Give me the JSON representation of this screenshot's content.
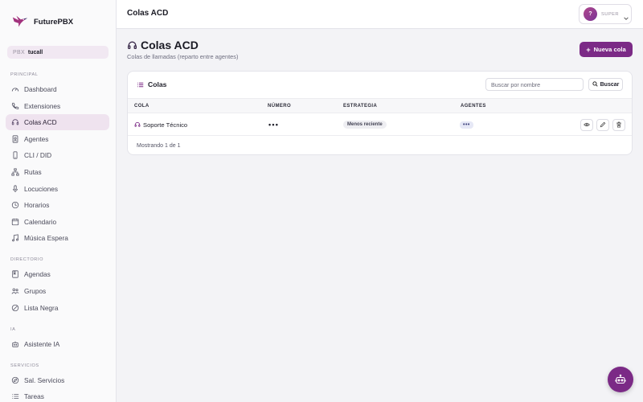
{
  "brand": {
    "name": "FuturePBX"
  },
  "pbx": {
    "label": "PBX",
    "value": "tucall"
  },
  "sidebar": {
    "sections": [
      {
        "title": "PRINCIPAL",
        "items": [
          {
            "label": "Dashboard",
            "icon": "dashboard-icon"
          },
          {
            "label": "Extensiones",
            "icon": "phone-icon"
          },
          {
            "label": "Colas ACD",
            "icon": "headset-icon",
            "active": true
          },
          {
            "label": "Agentes",
            "icon": "id-badge-icon"
          },
          {
            "label": "CLI / DID",
            "icon": "mobile-icon"
          },
          {
            "label": "Rutas",
            "icon": "routes-icon"
          },
          {
            "label": "Locuciones",
            "icon": "microphone-icon"
          },
          {
            "label": "Horarios",
            "icon": "clock-icon"
          },
          {
            "label": "Calendario",
            "icon": "calendar-icon"
          },
          {
            "label": "Música Espera",
            "icon": "music-icon"
          }
        ]
      },
      {
        "title": "DIRECTORIO",
        "items": [
          {
            "label": "Agendas",
            "icon": "book-icon"
          },
          {
            "label": "Grupos",
            "icon": "users-icon"
          },
          {
            "label": "Lista Negra",
            "icon": "block-icon"
          }
        ]
      },
      {
        "title": "IA",
        "items": [
          {
            "label": "Asistente IA",
            "icon": "robot-icon"
          }
        ]
      },
      {
        "title": "SERVICIOS",
        "items": [
          {
            "label": "Sal. Servicios",
            "icon": "compass-icon"
          },
          {
            "label": "Tareas",
            "icon": "list-icon"
          }
        ]
      }
    ]
  },
  "topbar": {
    "title": "Colas ACD",
    "avatar_initial": "?",
    "role": "SUPER"
  },
  "page": {
    "title": "Colas ACD",
    "subtitle": "Colas de llamadas (reparto entre agentes)",
    "new_button": "Nueva cola"
  },
  "card": {
    "title": "Colas",
    "search_placeholder": "Buscar por nombre",
    "search_button": "Buscar",
    "columns": [
      "COLA",
      "NÚMERO",
      "ESTRATEGIA",
      "AGENTES"
    ],
    "rows": [
      {
        "cola": "Soporte Técnico",
        "numero": "•••",
        "estrategia": "Menos reciente",
        "agentes": "•••"
      }
    ],
    "footer": "Mostrando 1 de 1"
  },
  "colors": {
    "accent": "#7b2a86",
    "active_bg": "#efe3ef"
  }
}
